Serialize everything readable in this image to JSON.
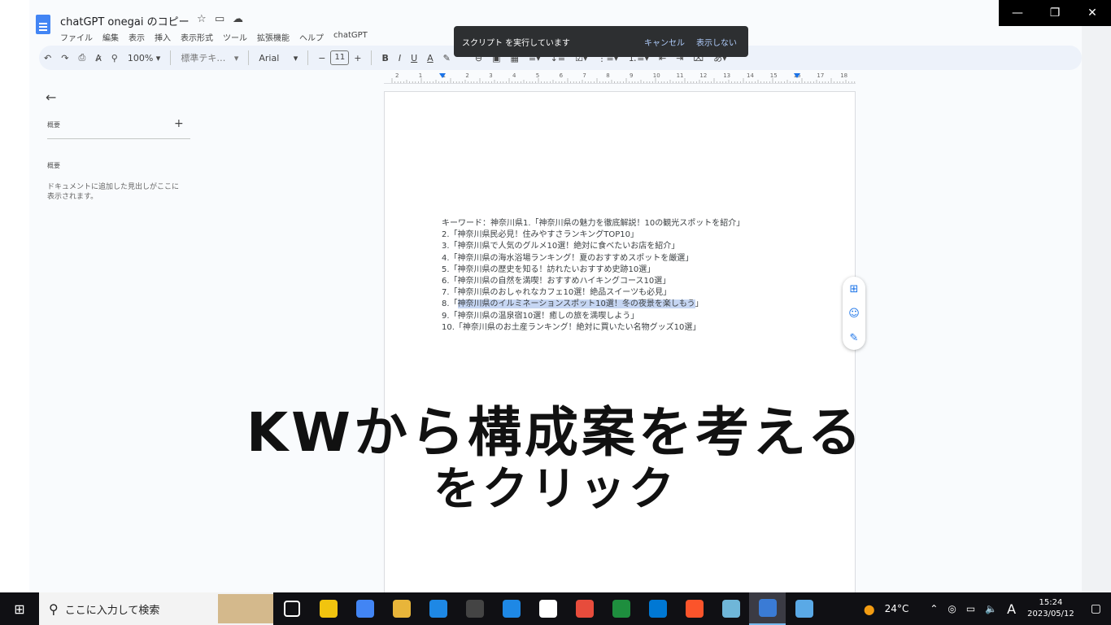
{
  "window": {
    "title": "chatGPT onegai のコピー"
  },
  "menu": [
    "ファイル",
    "編集",
    "表示",
    "挿入",
    "表示形式",
    "ツール",
    "拡張機能",
    "ヘルプ",
    "chatGPT"
  ],
  "toast": {
    "message": "スクリプト を実行しています",
    "cancel": "キャンセル",
    "hide": "表示しない"
  },
  "toolbar": {
    "zoom": "100%",
    "style": "標準テキ…",
    "font": "Arial",
    "font_size": "11",
    "input_tool": "あ"
  },
  "ruler": {
    "ticks": [
      "2",
      "1",
      "1",
      "2",
      "3",
      "4",
      "5",
      "6",
      "7",
      "8",
      "9",
      "10",
      "11",
      "12",
      "13",
      "14",
      "15",
      "16",
      "17",
      "18"
    ]
  },
  "sidebar": {
    "title": "概要",
    "section": "概要",
    "hint": "ドキュメントに追加した見出しがここに表示されます。"
  },
  "document": {
    "lines": [
      "キーワード：神奈川県1.「神奈川県の魅力を徹底解説！10の観光スポットを紹介」",
      "2.「神奈川県民必見！住みやすさランキングTOP10」",
      "3.「神奈川県で人気のグルメ10選！絶対に食べたいお店を紹介」",
      "4.「神奈川県の海水浴場ランキング！夏のおすすめスポットを厳選」",
      "5.「神奈川県の歴史を知る！訪れたいおすすめ史跡10選」",
      "6.「神奈川県の自然を満喫！おすすめハイキングコース10選」",
      "7.「神奈川県のおしゃれなカフェ10選！絶品スイーツも必見」"
    ],
    "line8_prefix": "8.「",
    "line8_highlight": "神奈川県のイルミネーションスポット10選！冬の夜景を楽しもう",
    "line8_suffix": "」",
    "lines_after": [
      "9.「神奈川県の温泉宿10選！癒しの旅を満喫しよう」",
      "10.「神奈川県のお土産ランキング！絶対に買いたい名物グッズ10選」"
    ]
  },
  "overlay": {
    "line1": "KWから構成案を考える",
    "line2": "をクリック"
  },
  "taskbar": {
    "search_placeholder": "ここに入力して検索",
    "weather": "24°C",
    "ime": "A",
    "time": "15:24",
    "date": "2023/05/12",
    "app_colors": [
      "#ffffff",
      "#f1c40f",
      "#4285f4",
      "#e8b53a",
      "#1e88e5",
      "#444444",
      "#1e88e5",
      "#ffffff",
      "#e74c3c",
      "#1e8e3e",
      "#0078d4",
      "#fb542b",
      "#6fb6d8",
      "#3a7bd5",
      "#5aa9e6"
    ]
  },
  "colors": {
    "accent": "#1a73e8",
    "highlight": "#c6d6f3",
    "doc_blue": "#4285f4"
  }
}
